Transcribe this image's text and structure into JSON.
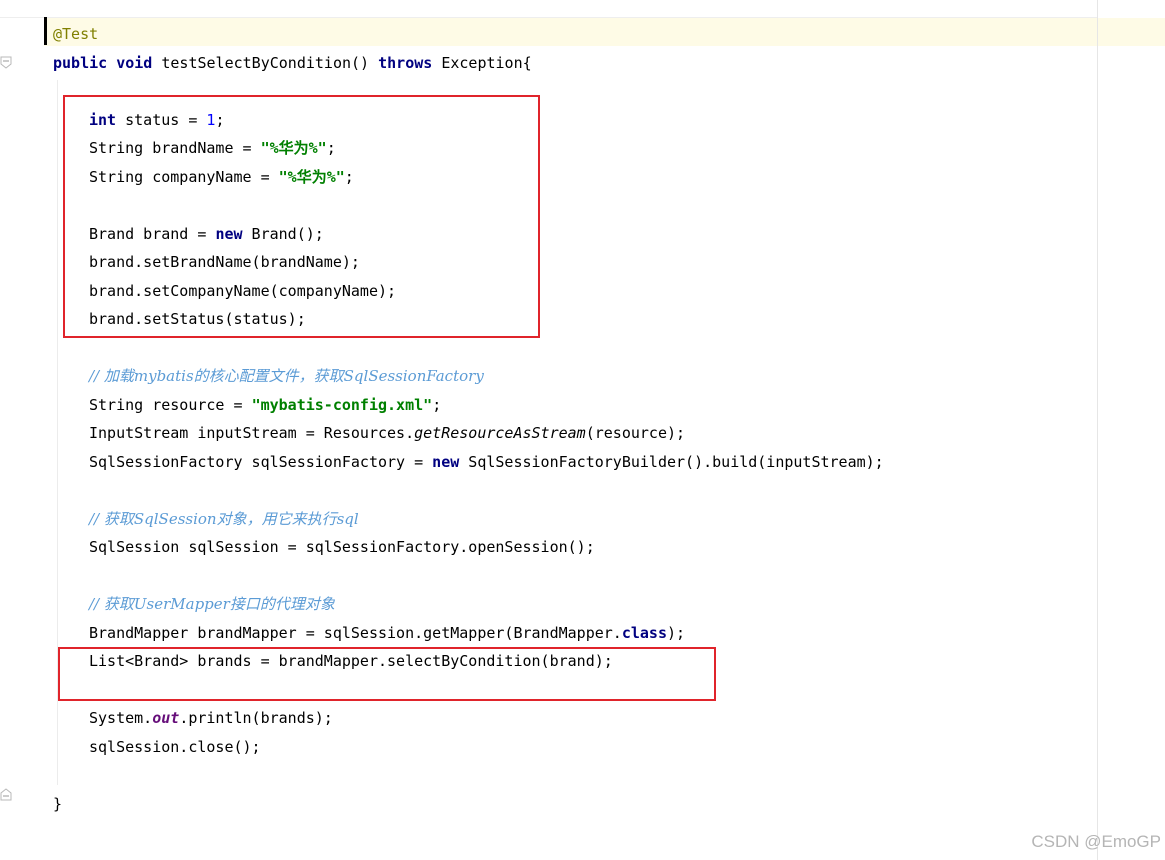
{
  "editor": {
    "lines": [
      {
        "indent": 0,
        "tokens": [
          {
            "t": "@Test",
            "c": "ann"
          }
        ]
      },
      {
        "indent": 0,
        "tokens": [
          {
            "t": "public",
            "c": "kw"
          },
          {
            "t": " "
          },
          {
            "t": "void",
            "c": "kw"
          },
          {
            "t": " testSelectByCondition() "
          },
          {
            "t": "throws",
            "c": "kw"
          },
          {
            "t": " Exception{"
          }
        ]
      },
      {
        "indent": 0,
        "tokens": []
      },
      {
        "indent": 1,
        "tokens": [
          {
            "t": "int",
            "c": "kw"
          },
          {
            "t": " status = "
          },
          {
            "t": "1",
            "c": "num"
          },
          {
            "t": ";"
          }
        ]
      },
      {
        "indent": 1,
        "tokens": [
          {
            "t": "String brandName = "
          },
          {
            "t": "\"%华为%\"",
            "c": "str"
          },
          {
            "t": ";"
          }
        ]
      },
      {
        "indent": 1,
        "tokens": [
          {
            "t": "String companyName = "
          },
          {
            "t": "\"%华为%\"",
            "c": "str"
          },
          {
            "t": ";"
          }
        ]
      },
      {
        "indent": 1,
        "tokens": []
      },
      {
        "indent": 1,
        "tokens": [
          {
            "t": "Brand brand = "
          },
          {
            "t": "new",
            "c": "kw"
          },
          {
            "t": " Brand();"
          }
        ]
      },
      {
        "indent": 1,
        "tokens": [
          {
            "t": "brand.setBrandName(brandName);"
          }
        ]
      },
      {
        "indent": 1,
        "tokens": [
          {
            "t": "brand.setCompanyName(companyName);"
          }
        ]
      },
      {
        "indent": 1,
        "tokens": [
          {
            "t": "brand.setStatus(status);"
          }
        ]
      },
      {
        "indent": 1,
        "tokens": []
      },
      {
        "indent": 1,
        "tokens": [
          {
            "t": "// 加载mybatis的核心配置文件，获取SqlSessionFactory",
            "c": "cmt"
          }
        ]
      },
      {
        "indent": 1,
        "tokens": [
          {
            "t": "String resource = "
          },
          {
            "t": "\"mybatis-config.xml\"",
            "c": "str"
          },
          {
            "t": ";"
          }
        ]
      },
      {
        "indent": 1,
        "tokens": [
          {
            "t": "InputStream inputStream = Resources."
          },
          {
            "t": "getResourceAsStream",
            "c": "ital"
          },
          {
            "t": "(resource);"
          }
        ]
      },
      {
        "indent": 1,
        "tokens": [
          {
            "t": "SqlSessionFactory sqlSessionFactory = "
          },
          {
            "t": "new",
            "c": "kw"
          },
          {
            "t": " SqlSessionFactoryBuilder().build(inputStream);"
          }
        ]
      },
      {
        "indent": 1,
        "tokens": []
      },
      {
        "indent": 1,
        "tokens": [
          {
            "t": "// 获取SqlSession对象，用它来执行sql",
            "c": "cmt"
          }
        ]
      },
      {
        "indent": 1,
        "tokens": [
          {
            "t": "SqlSession sqlSession = sqlSessionFactory.openSession();"
          }
        ]
      },
      {
        "indent": 1,
        "tokens": []
      },
      {
        "indent": 1,
        "tokens": [
          {
            "t": "// 获取UserMapper接口的代理对象",
            "c": "cmt"
          }
        ]
      },
      {
        "indent": 1,
        "tokens": [
          {
            "t": "BrandMapper brandMapper = sqlSession.getMapper(BrandMapper."
          },
          {
            "t": "class",
            "c": "kw"
          },
          {
            "t": ");"
          }
        ]
      },
      {
        "indent": 1,
        "tokens": [
          {
            "t": "List<Brand> brands = brandMapper.selectByCondition(brand);"
          }
        ]
      },
      {
        "indent": 1,
        "tokens": []
      },
      {
        "indent": 1,
        "tokens": [
          {
            "t": "System."
          },
          {
            "t": "out",
            "c": "static"
          },
          {
            "t": ".println(brands);"
          }
        ]
      },
      {
        "indent": 1,
        "tokens": [
          {
            "t": "sqlSession.close();"
          }
        ]
      },
      {
        "indent": 1,
        "tokens": []
      },
      {
        "indent": 0,
        "tokens": [
          {
            "t": "}"
          }
        ]
      }
    ]
  },
  "annotations": {
    "box_color": "#e0242b"
  },
  "watermark": "CSDN @EmoGP"
}
